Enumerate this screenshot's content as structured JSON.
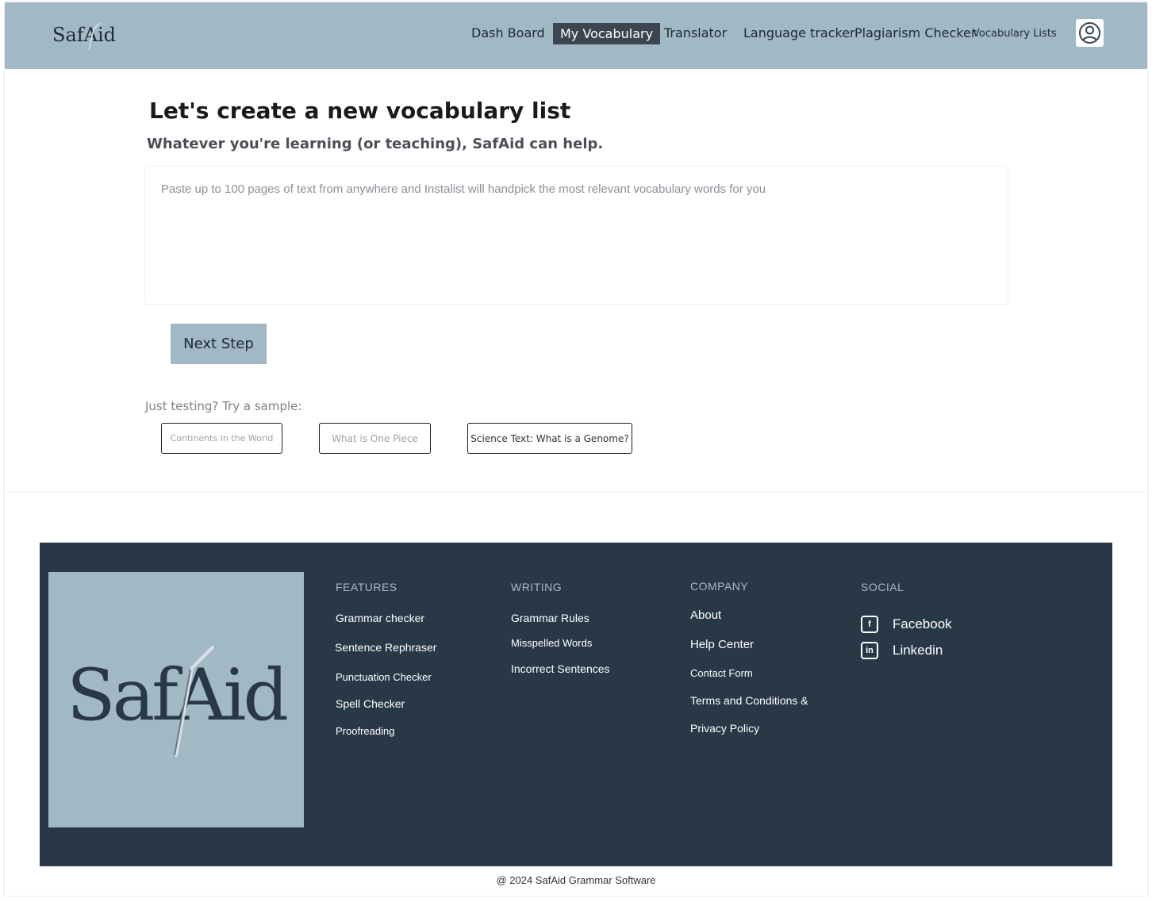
{
  "brand": {
    "logo_text": "SafAid"
  },
  "nav": {
    "items": [
      {
        "label": "Dash Board"
      },
      {
        "label": "My Vocabulary",
        "active": true
      },
      {
        "label": "Translator"
      },
      {
        "label": "Language tracker"
      },
      {
        "label": "Plagiarism Checker"
      },
      {
        "label": "Vocabulary Lists"
      }
    ],
    "avatar_icon": "user-circle-icon"
  },
  "main": {
    "title": "Let's create a new vocabulary list",
    "subtitle": "Whatever you're learning (or teaching), SafAid can help.",
    "text_input": {
      "placeholder": "Paste up to 100 pages of text from anywhere and Instalist will handpick the most relevant vocabulary words for you",
      "value": ""
    },
    "next_button": "Next Step",
    "sample_label": "Just testing? Try a sample:",
    "samples": [
      {
        "label": "Continents In the World"
      },
      {
        "label": "What is One Piece"
      },
      {
        "label": "Science Text: What is a Genome?"
      }
    ]
  },
  "footer": {
    "logo_text": "SafAid",
    "features": {
      "heading": "FEATURES",
      "links": [
        "Grammar checker",
        "Sentence Rephraser",
        "Punctuation Checker",
        "Spell Checker",
        "Proofreading"
      ]
    },
    "writing": {
      "heading": "WRITING",
      "links": [
        "Grammar Rules",
        "Misspelled Words",
        "Incorrect Sentences"
      ]
    },
    "company": {
      "heading": "COMPANY",
      "links": [
        "About",
        "Help Center",
        "Contact Form",
        "Terms and Conditions &",
        "Privacy Policy"
      ]
    },
    "social": {
      "heading": "SOCIAL",
      "links": [
        {
          "label": "Facebook",
          "icon": "facebook-icon"
        },
        {
          "label": "Linkedin",
          "icon": "linkedin-icon"
        }
      ]
    },
    "copyright": "@ 2024  SafAid Grammar Software"
  },
  "colors": {
    "header_bg": "#a1b8c5",
    "nav_active_bg": "#3b4650",
    "footer_bg": "#283847",
    "button_bg": "#a1b8c5"
  }
}
